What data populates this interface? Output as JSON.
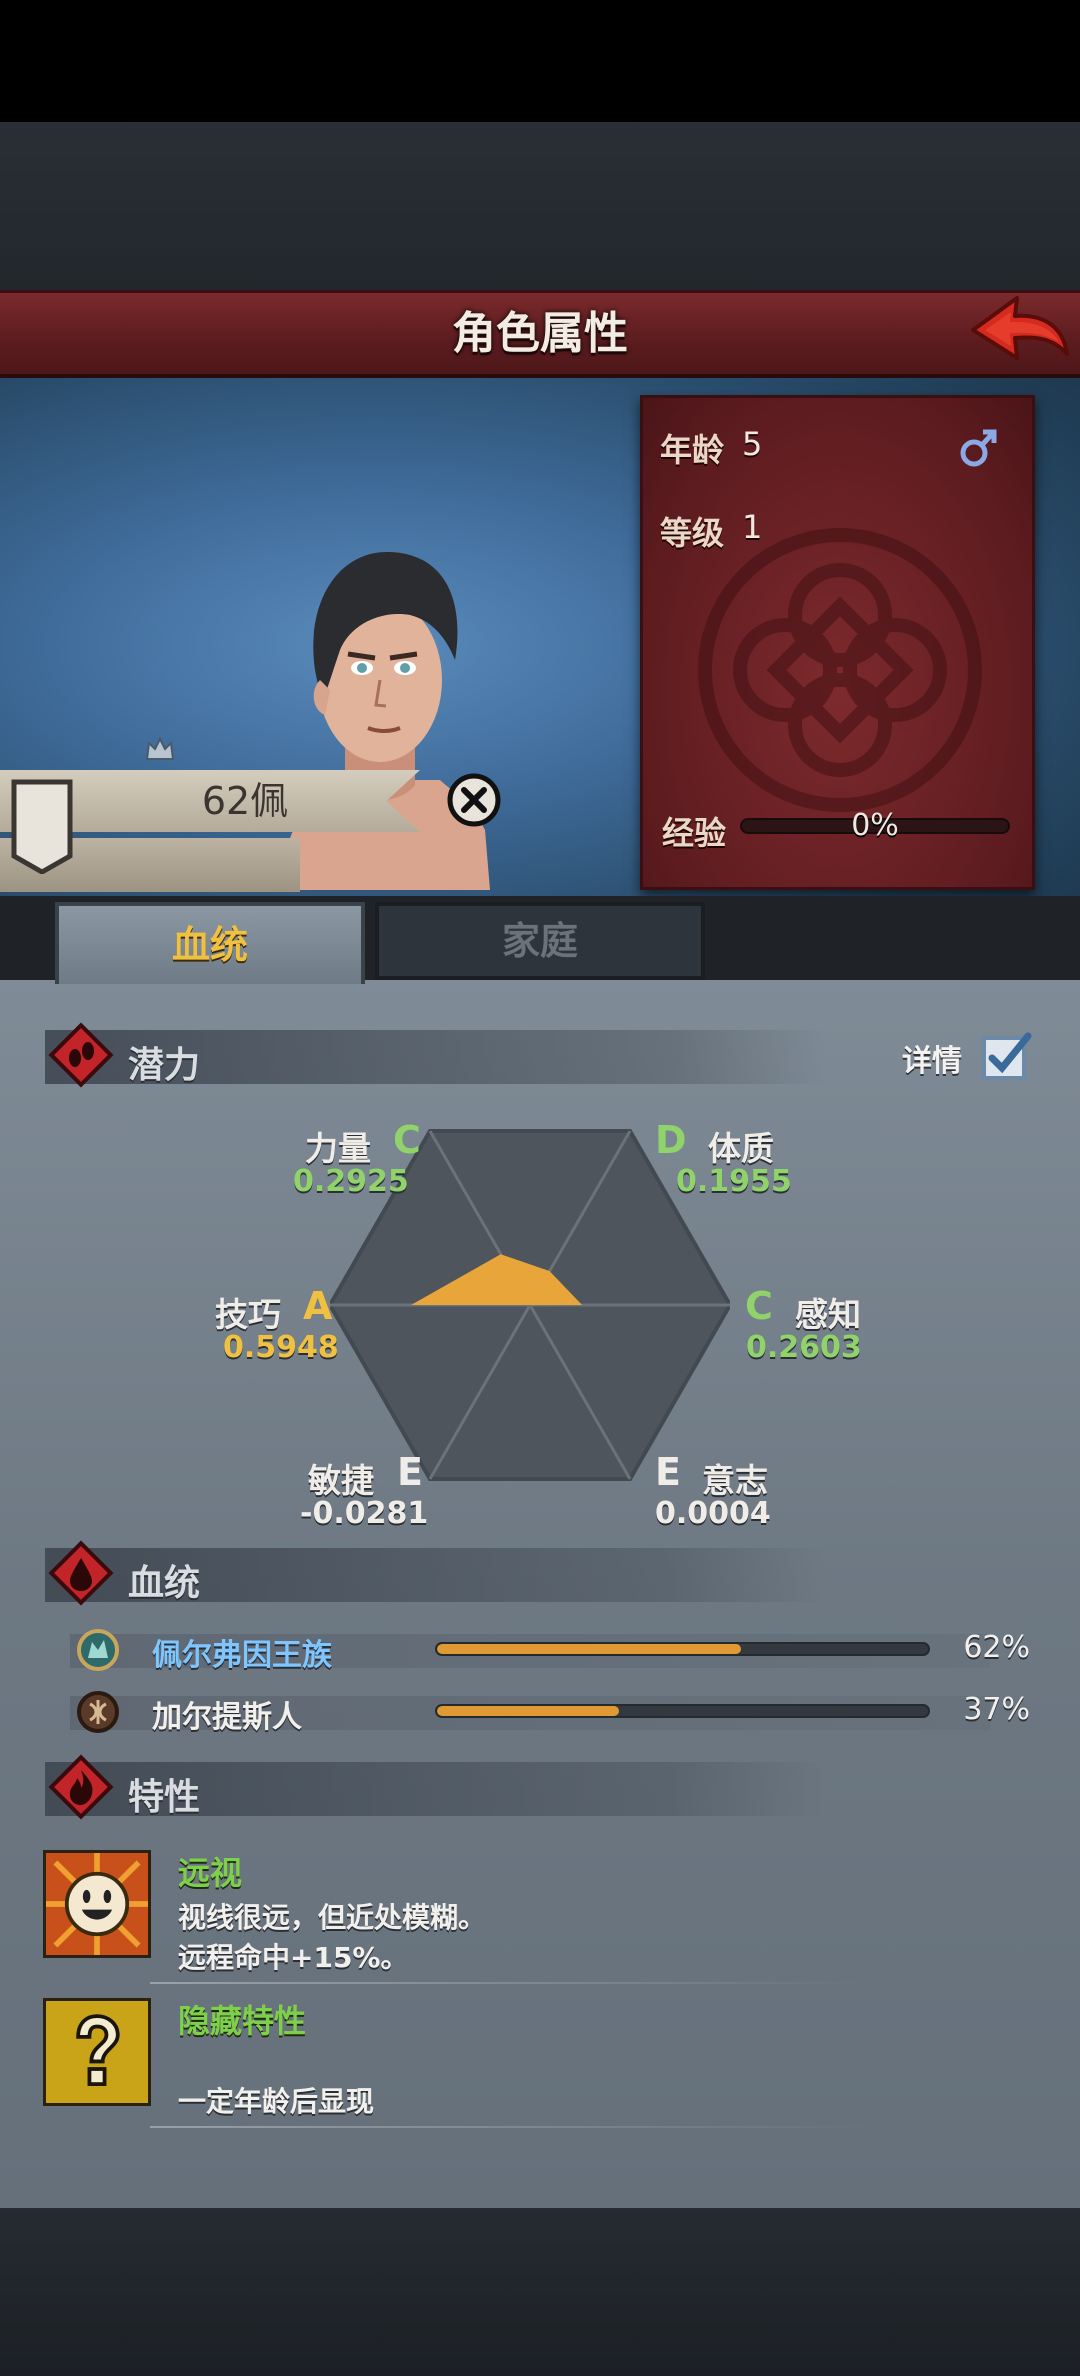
{
  "header": {
    "title": "角色属性"
  },
  "character": {
    "name": "62佩",
    "age_label": "年龄",
    "age_value": "5",
    "level_label": "等级",
    "level_value": "1",
    "gender": "male",
    "exp_label": "经验",
    "exp_text": "0%",
    "exp_fraction": 0
  },
  "tabs": [
    {
      "label": "血统",
      "active": true
    },
    {
      "label": "家庭",
      "active": false
    }
  ],
  "potential": {
    "title": "潜力",
    "detail_label": "详情",
    "detail_checked": true,
    "stats": [
      {
        "name": "力量",
        "grade": "C",
        "value": "0.2925",
        "color": "#8fd36a"
      },
      {
        "name": "体质",
        "grade": "D",
        "value": "0.1955",
        "color": "#8fd36a"
      },
      {
        "name": "感知",
        "grade": "C",
        "value": "0.2603",
        "color": "#8fd36a"
      },
      {
        "name": "意志",
        "grade": "E",
        "value": "0.0004",
        "color": "#f0ede8"
      },
      {
        "name": "敏捷",
        "grade": "E",
        "value": "-0.0281",
        "color": "#f0ede8"
      },
      {
        "name": "技巧",
        "grade": "A",
        "value": "0.5948",
        "color": "#f0c040"
      }
    ]
  },
  "bloodline": {
    "title": "血统",
    "items": [
      {
        "name": "佩尔弗因王族",
        "percent_text": "62%",
        "fraction": 0.62,
        "color": "#7fc6ff"
      },
      {
        "name": "加尔提斯人",
        "percent_text": "37%",
        "fraction": 0.37,
        "color": "#f2f0ec"
      }
    ]
  },
  "traits": {
    "title": "特性",
    "items": [
      {
        "name": "远视",
        "line1": "视线很远，但近处模糊。",
        "line2": "远程命中+15%。",
        "icon": "smiley-face-icon"
      },
      {
        "name": "隐藏特性",
        "line1": "",
        "line2": "一定年龄后显现",
        "icon": "question-mark-icon"
      }
    ]
  },
  "colors": {
    "accent": "#e09a35",
    "title_bar": "#5c1c1f",
    "trait_name": "#7ed04a"
  }
}
